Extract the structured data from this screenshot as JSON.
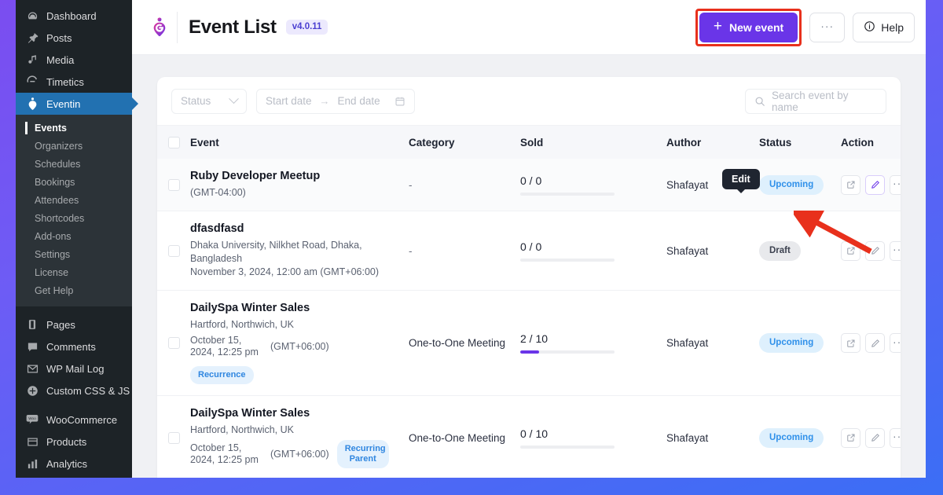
{
  "sidebar": {
    "top_items": [
      {
        "label": "Dashboard",
        "icon": "dashboard-icon"
      },
      {
        "label": "Posts",
        "icon": "pin-icon"
      },
      {
        "label": "Media",
        "icon": "media-icon"
      },
      {
        "label": "Timetics",
        "icon": "timetics-icon"
      }
    ],
    "active_item": {
      "label": "Eventin",
      "icon": "eventin-icon"
    },
    "submenu": [
      {
        "label": "Events",
        "current": true
      },
      {
        "label": "Organizers",
        "current": false
      },
      {
        "label": "Schedules",
        "current": false
      },
      {
        "label": "Bookings",
        "current": false
      },
      {
        "label": "Attendees",
        "current": false
      },
      {
        "label": "Shortcodes",
        "current": false
      },
      {
        "label": "Add-ons",
        "current": false
      },
      {
        "label": "Settings",
        "current": false
      },
      {
        "label": "License",
        "current": false
      },
      {
        "label": "Get Help",
        "current": false
      }
    ],
    "group_two": [
      {
        "label": "Pages",
        "icon": "pages-icon"
      },
      {
        "label": "Comments",
        "icon": "comment-icon"
      },
      {
        "label": "WP Mail Log",
        "icon": "envelope-icon"
      },
      {
        "label": "Custom CSS & JS",
        "icon": "plus-circle-icon"
      }
    ],
    "group_three": [
      {
        "label": "WooCommerce",
        "icon": "woocommerce-icon"
      },
      {
        "label": "Products",
        "icon": "products-icon"
      },
      {
        "label": "Analytics",
        "icon": "analytics-icon"
      }
    ]
  },
  "header": {
    "logo_icon": "eventin-logo-icon",
    "title": "Event List",
    "version": "v4.0.11",
    "new_event_label": "New event",
    "new_event_plus": "+",
    "more_label": "···",
    "help_label": "Help",
    "help_icon": "info-circle-icon",
    "accent_color": "#6a35e8",
    "annotation_color": "#e8301c"
  },
  "filters": {
    "status_placeholder": "Status",
    "status_chevron": "chevron-down-icon",
    "start_date_placeholder": "Start date",
    "range_arrow": "→",
    "end_date_placeholder": "End date",
    "calendar_icon": "calendar-icon",
    "search_placeholder": "Search event by name",
    "search_icon": "search-icon"
  },
  "table": {
    "columns": [
      "Event",
      "Category",
      "Sold",
      "Author",
      "Status",
      "Action"
    ],
    "rows": [
      {
        "title": "Ruby Developer Meetup",
        "location": "",
        "date": "",
        "timezone": "(GMT-04:00)",
        "badge": "",
        "category": "-",
        "sold": "0 / 0",
        "sold_percent": 0,
        "author": "Shafayat",
        "status": "Upcoming",
        "status_kind": "upcoming"
      },
      {
        "title": "dfasdfasd",
        "location": "Dhaka University, Nilkhet Road, Dhaka, Bangladesh",
        "date": "November 3, 2024, 12:00 am (GMT+06:00)",
        "timezone": "",
        "badge": "",
        "category": "-",
        "sold": "0 / 0",
        "sold_percent": 0,
        "author": "Shafayat",
        "status": "Draft",
        "status_kind": "draft"
      },
      {
        "title": "DailySpa Winter Sales",
        "location": "Hartford, Northwich, UK",
        "date": "October 15, 2024, 12:25 pm",
        "timezone": "(GMT+06:00)",
        "badge": "Recurrence",
        "category": "One-to-One Meeting",
        "sold": "2 / 10",
        "sold_percent": 20,
        "author": "Shafayat",
        "status": "Upcoming",
        "status_kind": "upcoming"
      },
      {
        "title": "DailySpa Winter Sales",
        "location": "Hartford, Northwich, UK",
        "date": "October 15, 2024, 12:25 pm",
        "timezone": "(GMT+06:00)",
        "badge": "Recurring Parent",
        "category": "One-to-One Meeting",
        "sold": "0 / 10",
        "sold_percent": 0,
        "author": "Shafayat",
        "status": "Upcoming",
        "status_kind": "upcoming"
      }
    ],
    "action_icons": [
      "external-link-icon",
      "pencil-edit-icon",
      "ellipsis-icon"
    ]
  },
  "tooltip": {
    "text": "Edit"
  }
}
